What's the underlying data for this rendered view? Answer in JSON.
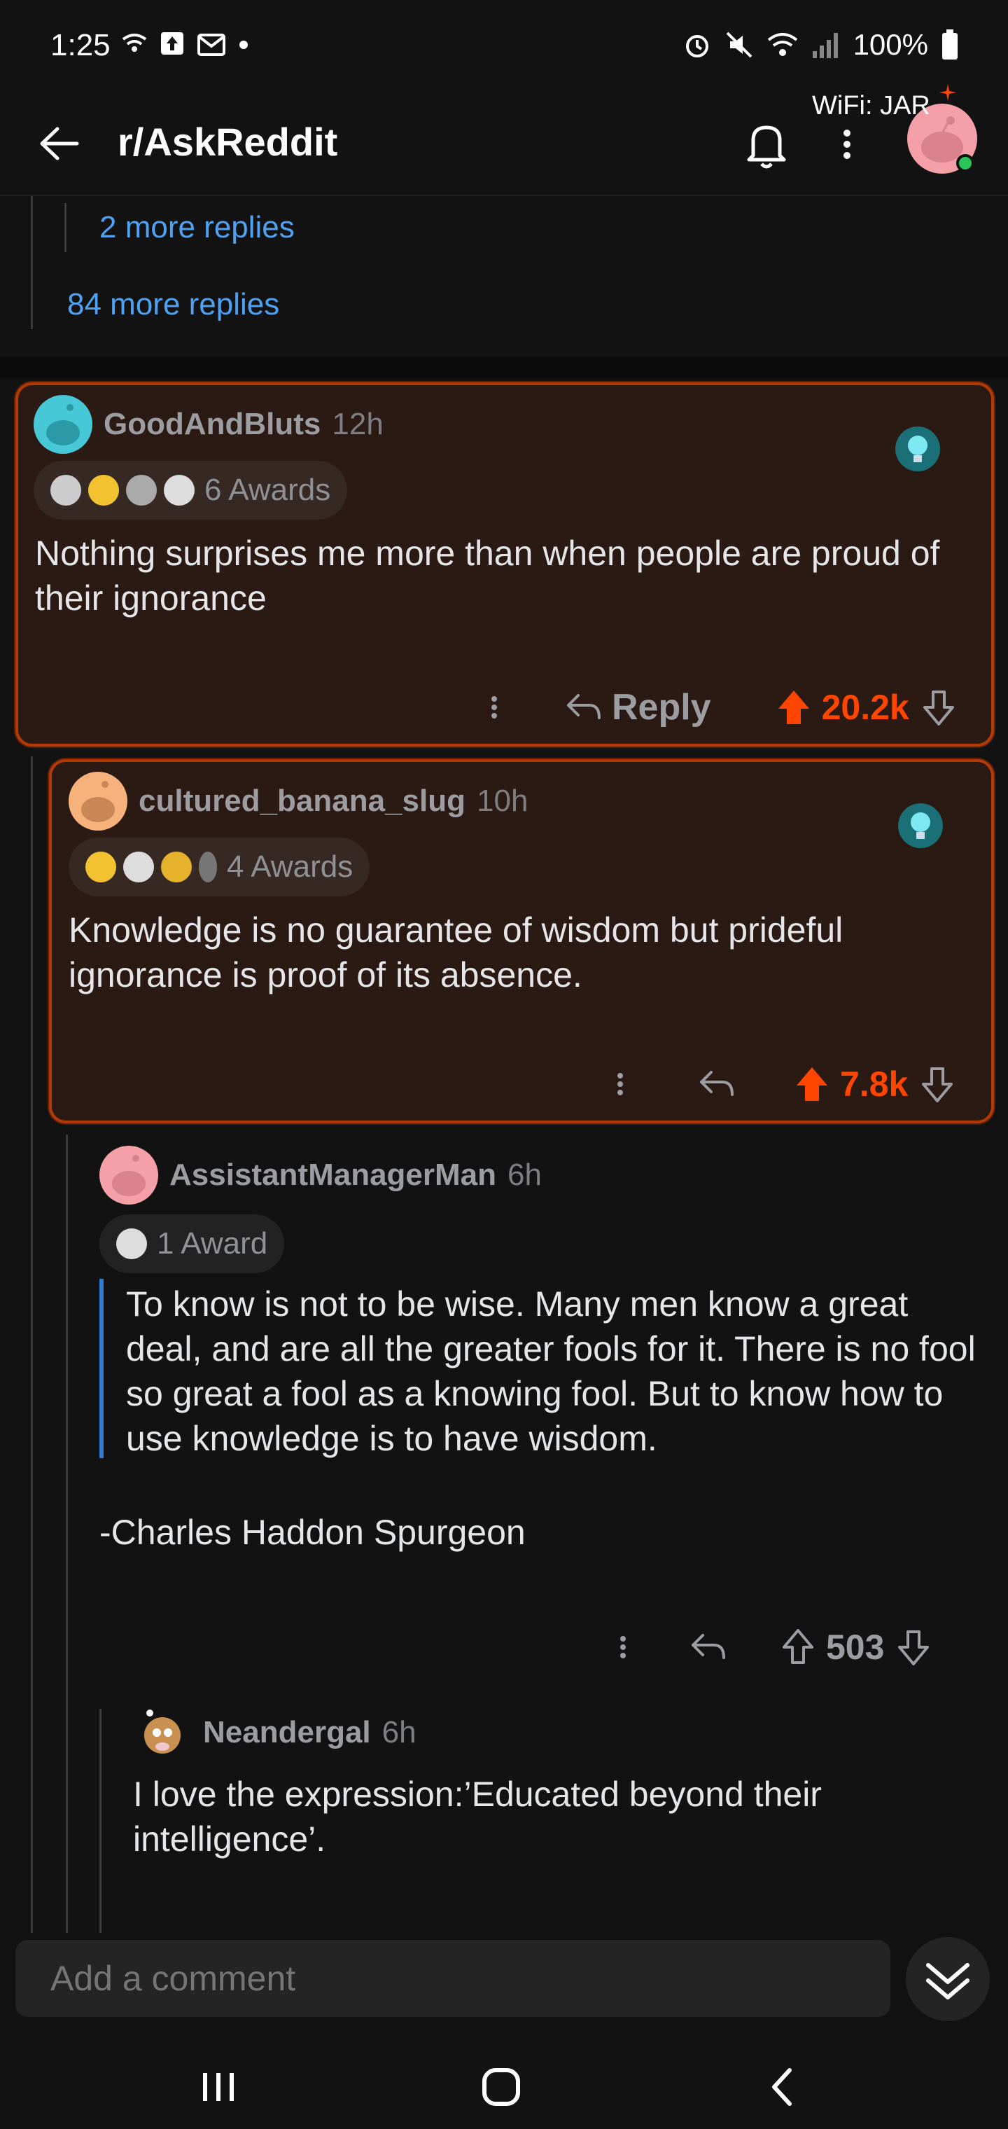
{
  "status_bar": {
    "time": "1:25",
    "battery": "100%"
  },
  "header": {
    "title": "r/AskReddit",
    "wifi_label": "WiFi: JAR"
  },
  "collapsed": {
    "nested_more": "2 more replies",
    "more": "84 more replies"
  },
  "comments": [
    {
      "username": "GoodAndBluts",
      "time": "12h",
      "awards": "6 Awards",
      "body": "Nothing surprises me more than when people are proud of their ignorance",
      "reply_label": "Reply",
      "score": "20.2k"
    },
    {
      "username": "cultured_banana_slug",
      "time": "10h",
      "awards": "4 Awards",
      "body": "Knowledge is no guarantee of wisdom but prideful ignorance is proof of its absence.",
      "score": "7.8k"
    },
    {
      "username": "AssistantManagerMan",
      "time": "6h",
      "awards": "1 Award",
      "quote": "To know is not to be wise. Many men know a great deal, and are all the greater fools for it. There is no fool so great a fool as a knowing fool. But to know how to use knowledge is to have wisdom.",
      "attribution": "-Charles Haddon Spurgeon",
      "score": "503"
    },
    {
      "username": "Neandergal",
      "time": "6h",
      "body": "I love the expression:’Educated beyond their intelligence’."
    }
  ],
  "composer": {
    "placeholder": "Add a comment"
  },
  "colors": {
    "accent": "#ff4500",
    "link": "#4fa1f2",
    "highlight_border": "#b13a07"
  }
}
